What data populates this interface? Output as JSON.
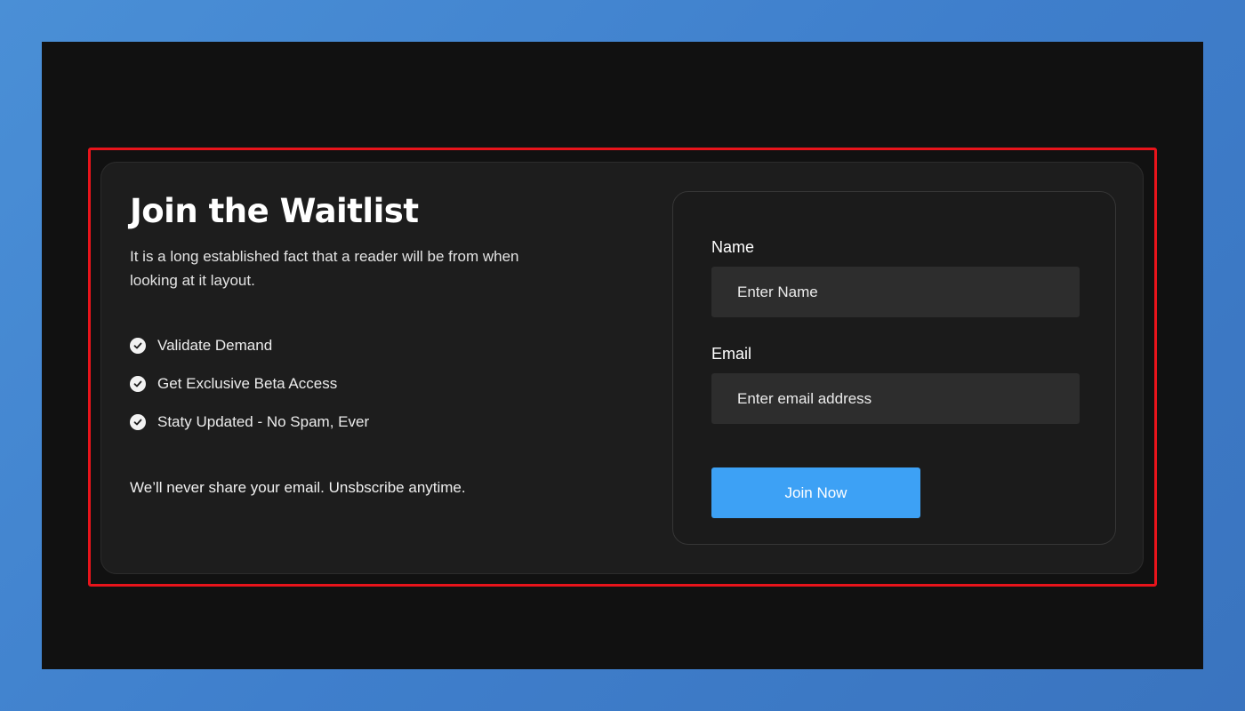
{
  "waitlist": {
    "title": "Join the Waitlist",
    "description": "It is a long established fact that a reader will be from when looking at it layout.",
    "features": [
      {
        "label": "Validate Demand",
        "icon": "check-circle-icon"
      },
      {
        "label": "Get Exclusive Beta Access",
        "icon": "check-circle-icon"
      },
      {
        "label": "Staty Updated - No Spam, Ever",
        "icon": "check-circle-icon"
      }
    ],
    "privacy_note": "We’ll never share your email. Unsbscribe anytime."
  },
  "form": {
    "name_label": "Name",
    "name_placeholder": "Enter Name",
    "email_label": "Email",
    "email_placeholder": "Enter email address",
    "submit_label": "Join Now"
  },
  "colors": {
    "background": "#3f7fcc",
    "stage": "#111111",
    "card": "#1d1d1d",
    "input": "#2d2d2d",
    "accent": "#3da1f5",
    "highlight": "#e8141b"
  }
}
